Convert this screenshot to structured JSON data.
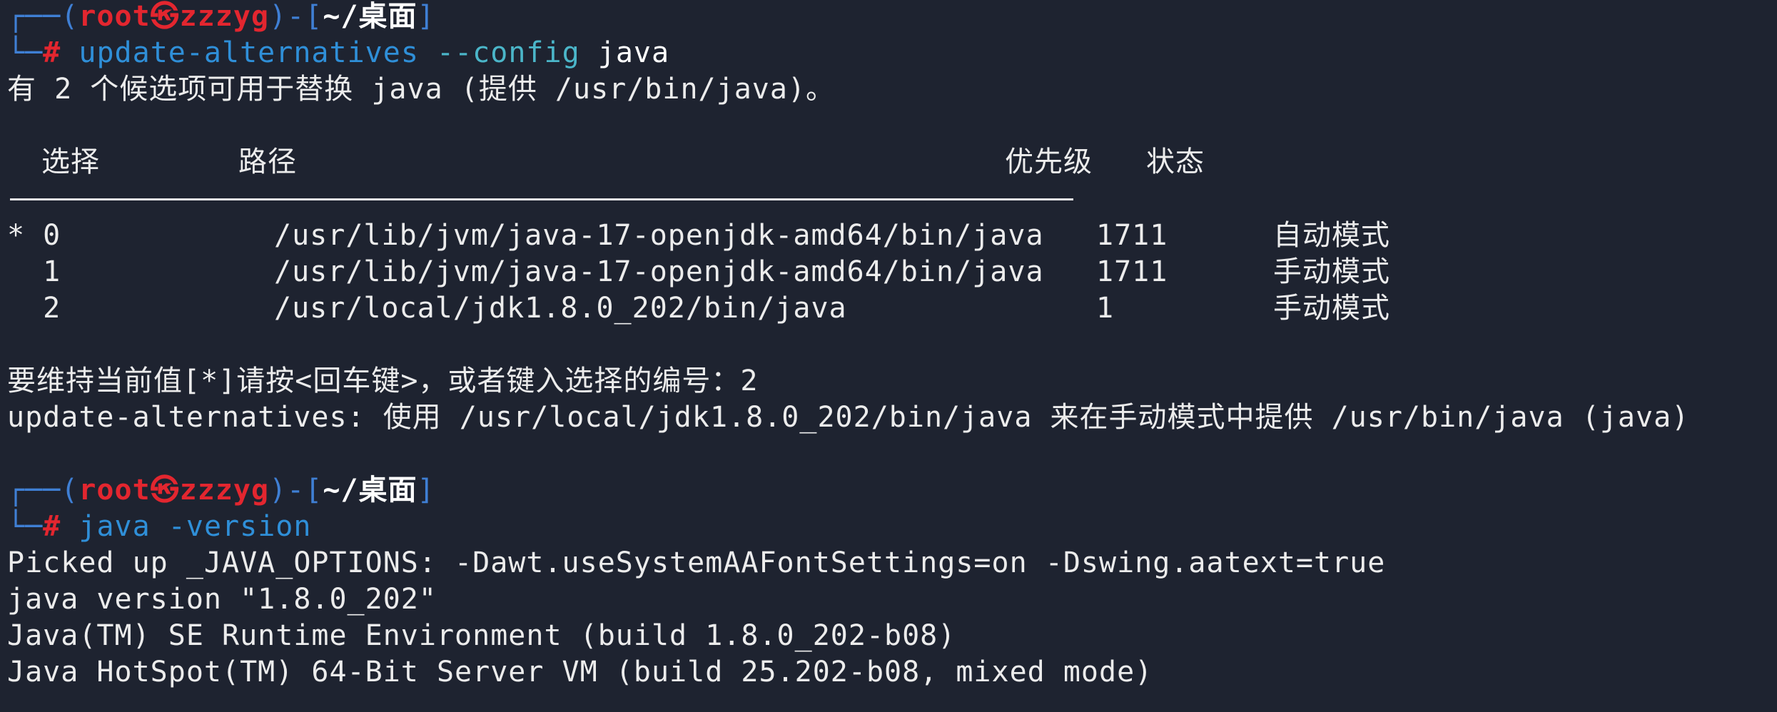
{
  "prompt1": {
    "box_top": "┌──(",
    "user": "root",
    "skull": "㉿",
    "host": "zzzyg",
    "sep": ")-[",
    "dir": "~/桌面",
    "close": "]",
    "box_bottom": "└─",
    "hash": "#",
    "command": "update-alternatives",
    "arg1": "--config",
    "arg2": "java"
  },
  "info_line": "有 2 个候选项可用于替换 java (提供 /usr/bin/java)。",
  "table": {
    "headers": {
      "select": "选择",
      "path": "路径",
      "priority": "优先级",
      "status": "状态"
    },
    "rows": [
      {
        "marker": "* 0",
        "path": "/usr/lib/jvm/java-17-openjdk-amd64/bin/java",
        "priority": "1711",
        "status": "自动模式"
      },
      {
        "marker": "  1",
        "path": "/usr/lib/jvm/java-17-openjdk-amd64/bin/java",
        "priority": "1711",
        "status": "手动模式"
      },
      {
        "marker": "  2",
        "path": "/usr/local/jdk1.8.0_202/bin/java",
        "priority": "1",
        "status": "手动模式"
      }
    ]
  },
  "choice_prompt": "要维持当前值[*]请按<回车键>，或者键入选择的编号：2",
  "choice_result": "update-alternatives: 使用 /usr/local/jdk1.8.0_202/bin/java 来在手动模式中提供 /usr/bin/java (java)",
  "prompt2": {
    "box_top": "┌──(",
    "user": "root",
    "skull": "㉿",
    "host": "zzzyg",
    "sep": ")-[",
    "dir": "~/桌面",
    "close": "]",
    "box_bottom": "└─",
    "hash": "#",
    "command": "java",
    "arg1": "-version"
  },
  "version_output": [
    "Picked up _JAVA_OPTIONS: -Dawt.useSystemAAFontSettings=on -Dswing.aatext=true",
    "java version \"1.8.0_202\"",
    "Java(TM) SE Runtime Environment (build 1.8.0_202-b08)",
    "Java HotSpot(TM) 64-Bit Server VM (build 25.202-b08, mixed mode)"
  ]
}
